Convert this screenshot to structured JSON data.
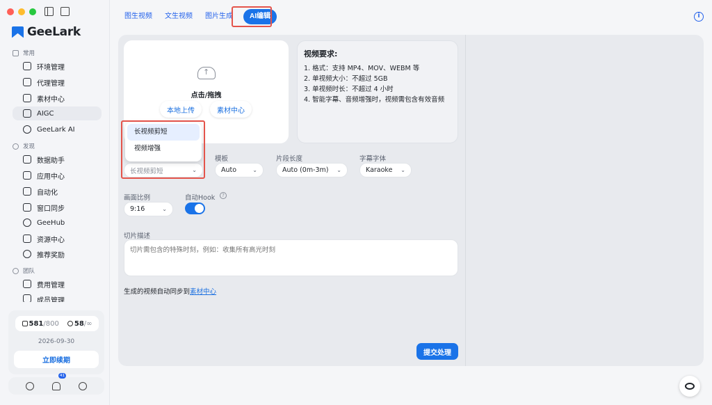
{
  "app": {
    "name": "GeeLark"
  },
  "sidebar": {
    "sections": [
      {
        "label": "常用"
      },
      {
        "label": "发现"
      },
      {
        "label": "团队"
      }
    ],
    "items": [
      {
        "label": "环境管理",
        "icon": "environment-icon"
      },
      {
        "label": "代理管理",
        "icon": "proxy-icon"
      },
      {
        "label": "素材中心",
        "icon": "image-icon"
      },
      {
        "label": "AIGC",
        "icon": "aigc-icon",
        "active": true
      },
      {
        "label": "GeeLark AI",
        "icon": "ai-icon"
      },
      {
        "label": "数据助手",
        "icon": "chart-icon"
      },
      {
        "label": "应用中心",
        "icon": "apps-icon"
      },
      {
        "label": "自动化",
        "icon": "robot-icon"
      },
      {
        "label": "窗口同步",
        "icon": "window-sync-icon"
      },
      {
        "label": "GeeHub",
        "icon": "geehub-icon"
      },
      {
        "label": "资源中心",
        "icon": "resources-icon"
      },
      {
        "label": "推荐奖励",
        "icon": "dollar-icon"
      },
      {
        "label": "费用管理",
        "icon": "billing-icon"
      },
      {
        "label": "成员管理",
        "icon": "members-icon"
      }
    ],
    "quota": {
      "profiles_used": "581",
      "profiles_total": "/800",
      "members_used": "58",
      "members_total": "/∞",
      "expire_date": "2026-09-30",
      "renew_label": "立即续期"
    },
    "notification_count": "41"
  },
  "tabs": [
    {
      "label": "图生视频"
    },
    {
      "label": "文生视频"
    },
    {
      "label": "图片生成"
    },
    {
      "label": "AI编辑",
      "active": true
    }
  ],
  "upload": {
    "title": "点击/拖拽",
    "local_upload": "本地上传",
    "material_center": "素材中心"
  },
  "requirements": {
    "title": "视频要求:",
    "lines": [
      "1. 格式：支持 MP4、MOV、WEBM 等",
      "2. 单视频大小：不超过 5GB",
      "3. 单视频时长：不超过 4 小时",
      "4. 智能字幕、音频增强时，视频需包含有效音频"
    ]
  },
  "form": {
    "function_options": [
      "长视频剪短",
      "视频增强"
    ],
    "function_value": "长视频剪短",
    "template_label": "模板",
    "template_value": "Auto",
    "segment_label": "片段长度",
    "segment_value": "Auto (0m-3m)",
    "font_label": "字幕字体",
    "font_value": "Karaoke",
    "ratio_label": "画面比例",
    "ratio_value": "9:16",
    "hook_label": "自动Hook",
    "hook_on": true,
    "desc_label": "切片描述",
    "desc_placeholder": "切片需包含的特殊时刻，例如：收集所有高光时刻",
    "sync_prefix": "生成的视频自动同步到",
    "sync_link": "素材中心",
    "submit_label": "提交处理"
  },
  "colors": {
    "accent": "#1a73e8",
    "highlight": "#e4544b"
  }
}
